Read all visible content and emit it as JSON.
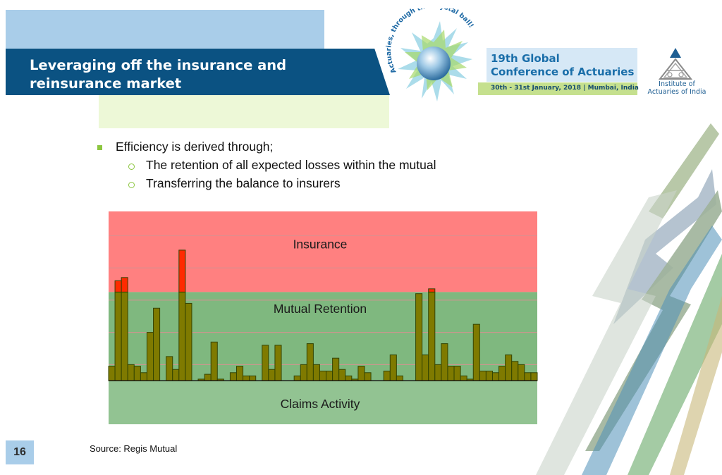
{
  "header": {
    "title_line1": "Leveraging off the insurance and",
    "title_line2": "reinsurance market",
    "conference_line1": "19th Global",
    "conference_line2": "Conference of Actuaries",
    "conference_dates": "30th - 31st January, 2018 | Mumbai, India",
    "logo_text": "Actuaries, through the crystal ball!",
    "institute_line1": "Institute of",
    "institute_line2": "Actuaries of India"
  },
  "bullets": {
    "main": "Efficiency is derived through;",
    "sub1": "The retention of all expected losses within the mutual",
    "sub2": "Transferring the balance to insurers"
  },
  "chart_data": {
    "type": "bar",
    "zones": [
      "Insurance",
      "Mutual Retention",
      "Claims Activity"
    ],
    "colors": {
      "insurance_zone": "#ff8080",
      "retention_zone": "#7fb87f",
      "bar_retained": "#7f7a00",
      "bar_insured": "#ff2a00",
      "bar_stroke": "#334400"
    },
    "values": [
      0.9,
      6.2,
      6.4,
      1.0,
      0.9,
      0.5,
      3.0,
      4.5,
      0,
      1.5,
      0.7,
      8.1,
      4.8,
      0,
      0.1,
      0.4,
      2.4,
      0.1,
      0,
      0.5,
      0.9,
      0.3,
      0.3,
      0,
      2.2,
      0.7,
      2.2,
      0,
      0,
      0.3,
      1.0,
      2.3,
      1.0,
      0.6,
      0.6,
      1.4,
      0.7,
      0.3,
      0.1,
      0.9,
      0.5,
      0,
      0,
      0.6,
      1.6,
      0.3,
      0,
      0,
      5.4,
      1.6,
      5.7,
      1.0,
      2.3,
      0.9,
      0.9,
      0.3,
      0.1,
      3.5,
      0.6,
      0.6,
      0.5,
      0.9,
      1.6,
      1.2,
      1.0,
      0.5,
      0.5
    ],
    "retention_level": 5.5,
    "ylim": [
      -2.7,
      10.5
    ]
  },
  "footer": {
    "source": "Source: Regis Mutual",
    "page_number": "16"
  }
}
